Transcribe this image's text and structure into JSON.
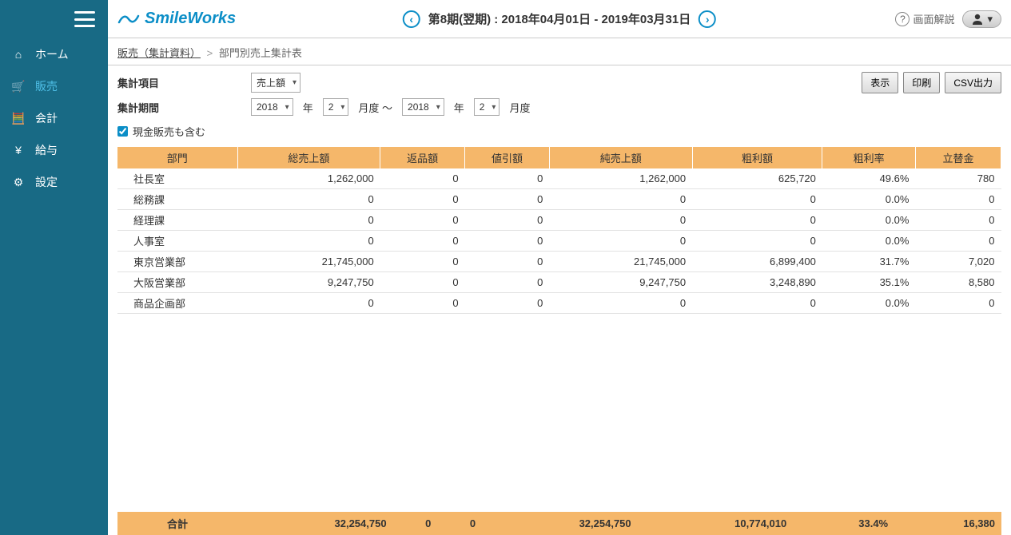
{
  "sidebar": {
    "items": [
      {
        "icon": "⌂",
        "label": "ホーム"
      },
      {
        "icon": "🛒",
        "label": "販売"
      },
      {
        "icon": "🧮",
        "label": "会計"
      },
      {
        "icon": "¥",
        "label": "給与"
      },
      {
        "icon": "⚙",
        "label": "設定"
      }
    ],
    "active_index": 1
  },
  "logo_text": "SmileWorks",
  "period_text": "第8期(翌期) : 2018年04月01日 - 2019年03月31日",
  "help_label": "画面解説",
  "breadcrumb": {
    "link": "販売（集計資料）",
    "current": "部門別売上集計表"
  },
  "filters": {
    "item_label": "集計項目",
    "item_selected": "売上額",
    "period_label": "集計期間",
    "year_from": "2018",
    "month_from": "2",
    "year_to": "2018",
    "month_to": "2",
    "year_suffix": "年",
    "month_suffix_from": "月度 〜",
    "month_suffix_to": "月度",
    "checkbox_checked": true,
    "checkbox_label": "現金販売も含む"
  },
  "actions": {
    "display": "表示",
    "print": "印刷",
    "csv": "CSV出力"
  },
  "table": {
    "headers": [
      "部門",
      "総売上額",
      "返品額",
      "値引額",
      "純売上額",
      "粗利額",
      "粗利率",
      "立替金"
    ],
    "rows": [
      {
        "dept": "社長室",
        "total": "1,262,000",
        "returns": "0",
        "disc": "0",
        "net": "1,262,000",
        "profit": "625,720",
        "rate": "49.6%",
        "adv": "780"
      },
      {
        "dept": "総務課",
        "total": "0",
        "returns": "0",
        "disc": "0",
        "net": "0",
        "profit": "0",
        "rate": "0.0%",
        "adv": "0"
      },
      {
        "dept": "経理課",
        "total": "0",
        "returns": "0",
        "disc": "0",
        "net": "0",
        "profit": "0",
        "rate": "0.0%",
        "adv": "0"
      },
      {
        "dept": "人事室",
        "total": "0",
        "returns": "0",
        "disc": "0",
        "net": "0",
        "profit": "0",
        "rate": "0.0%",
        "adv": "0"
      },
      {
        "dept": "東京営業部",
        "total": "21,745,000",
        "returns": "0",
        "disc": "0",
        "net": "21,745,000",
        "profit": "6,899,400",
        "rate": "31.7%",
        "adv": "7,020"
      },
      {
        "dept": "大阪営業部",
        "total": "9,247,750",
        "returns": "0",
        "disc": "0",
        "net": "9,247,750",
        "profit": "3,248,890",
        "rate": "35.1%",
        "adv": "8,580"
      },
      {
        "dept": "商品企画部",
        "total": "0",
        "returns": "0",
        "disc": "0",
        "net": "0",
        "profit": "0",
        "rate": "0.0%",
        "adv": "0"
      }
    ],
    "total_label": "合計",
    "totals": [
      "32,254,750",
      "0",
      "0",
      "32,254,750",
      "10,774,010",
      "33.4%",
      "16,380"
    ]
  }
}
